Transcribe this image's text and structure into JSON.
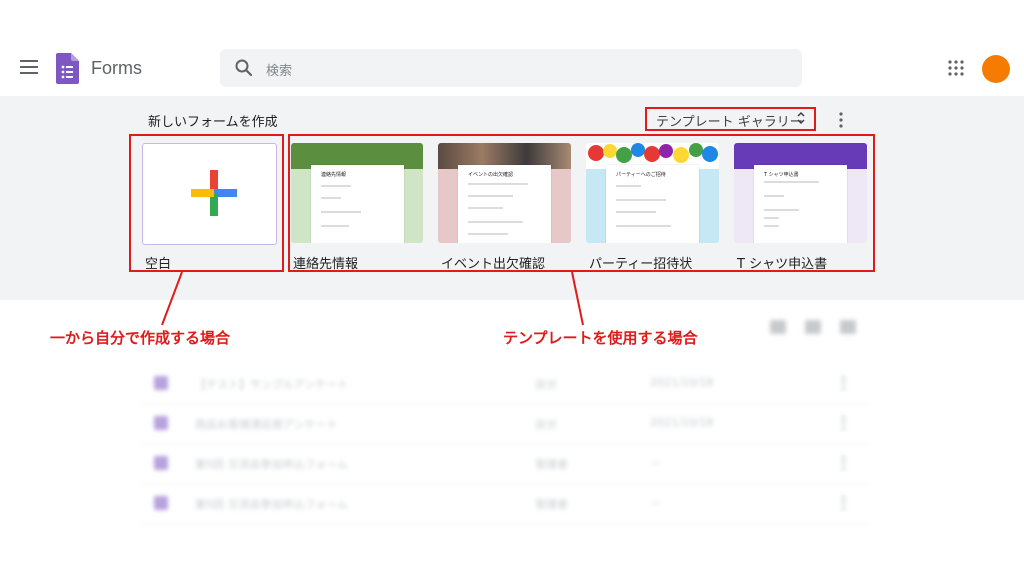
{
  "app": {
    "name": "Forms"
  },
  "search": {
    "placeholder": "検索"
  },
  "gallery": {
    "heading": "新しいフォームを作成",
    "gallery_button": "テンプレート ギャラリー",
    "blank": {
      "label": "空白"
    },
    "templates": [
      {
        "label": "連絡先情報",
        "preview_title": "連絡先情報",
        "accent": "#6aa84f"
      },
      {
        "label": "イベント出欠確認",
        "preview_title": "イベントの出欠確認",
        "accent": "#8e4a4a"
      },
      {
        "label": "パーティー招待状",
        "preview_title": "パーティーへのご招待",
        "accent": "#4fa3d1"
      },
      {
        "label": "T シャツ申込書",
        "preview_title": "T シャツ申込書",
        "accent": "#673ab7"
      }
    ]
  },
  "annotations": {
    "blank_note": "一から自分で作成する場合",
    "template_note": "テンプレートを使用する場合"
  },
  "recent": {
    "rows": [
      {
        "name": "【テスト】サンプルアンケート",
        "owner": "自分",
        "date": "2021/10/18"
      },
      {
        "name": "商品お客様満足度アンケート",
        "owner": "自分",
        "date": "2021/10/18"
      },
      {
        "name": "第5回 交流会参加申込フォーム",
        "owner": "管理者",
        "date": "—"
      },
      {
        "name": "第5回 交流会参加申込フォーム",
        "owner": "管理者",
        "date": "—"
      }
    ]
  },
  "colors": {
    "accent_red": "#e01b1b",
    "forms_purple": "#673ab7",
    "avatar": "#f57c00"
  }
}
